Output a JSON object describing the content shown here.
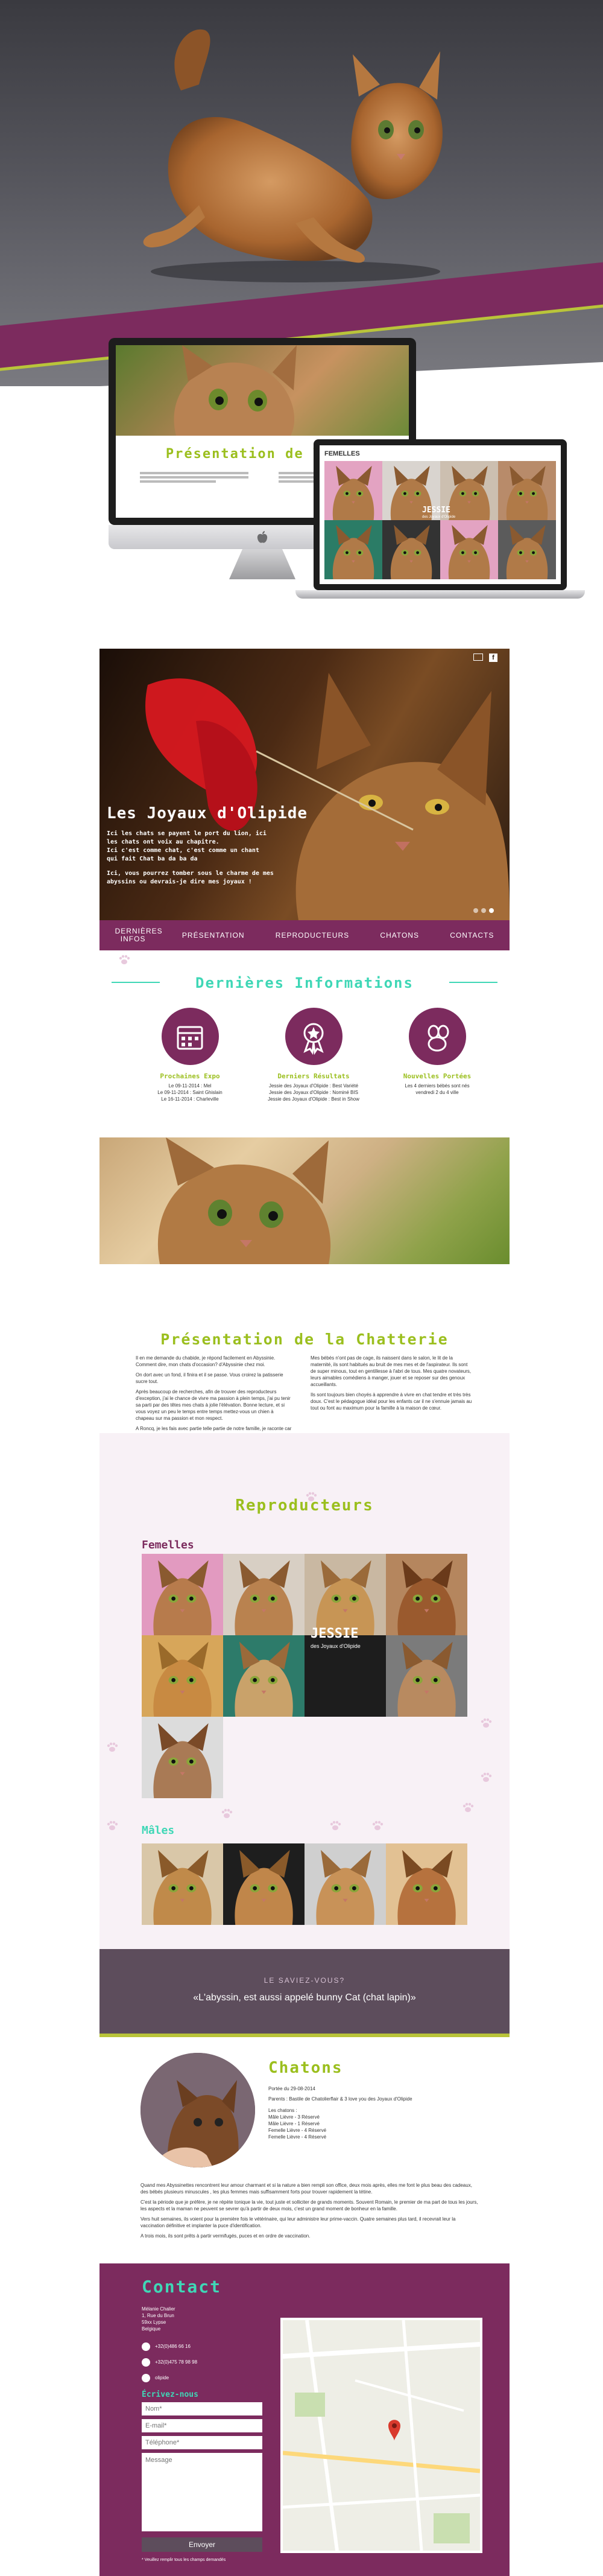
{
  "colors": {
    "purple": "#7c2b5e",
    "green": "#9bbf1e",
    "teal": "#3fd7b6",
    "dark": "#5d4d5c"
  },
  "mock": {
    "imac_title": "Présentation de la Ch",
    "laptop_label": "FEMELLES",
    "laptop_jessie": "JESSIE",
    "laptop_jessie_sub": "des Joyaux d'Olipide"
  },
  "slider": {
    "title": "Les Joyaux d'Olipide",
    "lines": [
      "Ici les chats se payent le port du lion, ici",
      "les chats ont voix au chapitre.",
      "Ici c'est comme chat, c'est comme un chant",
      "qui fait Chat ba da ba da"
    ],
    "line2": "Ici, vous pourrez tomber sous le charme de mes abyssins ou devrais-je dire mes joyaux !"
  },
  "nav": {
    "items": [
      "Dernières INFOS",
      "PRÉSENTATION",
      "REPRODUCTEURS",
      "CHATONS",
      "CONTACTS"
    ]
  },
  "infos": {
    "title": "Dernières Informations",
    "cols": [
      {
        "heading": "Prochaines Expo",
        "lines": [
          "Le 09-11-2014 : Mel",
          "Le 09-11-2014 : Saint Ghislain",
          "Le 16-11-2014 : Charleville"
        ],
        "icon": "calendar-icon"
      },
      {
        "heading": "Derniers Résultats",
        "lines": [
          "Jessie des Joyaux d'Olipide : Best Variété",
          "Jessie des Joyaux d'Olipide : Nominé BIS",
          "Jessie des Joyaux d'Olipide : Best in Show"
        ],
        "icon": "rosette-icon"
      },
      {
        "heading": "Nouvelles Portées",
        "lines": [
          "Les 4 derniers bébés sont nés",
          "vendredi 2 du 4 ville"
        ],
        "icon": "paw-icon"
      }
    ]
  },
  "presentation": {
    "title": "Présentation de la Chatterie",
    "left": [
      "Il en me demande du chabide, je répond facilement en Abyssinie. Comment dire, mon chats d'occasion? d'Abyssinie chez moi.",
      "On dort avec un fond, il finira et il se passe. Vous croirez la patisserie sucre tout.",
      "Après beaucoup de recherches, afin de trouver des reproducteurs d'exception, j'ai le chance de vivre ma passion à plein temps, j'ai pu tenir sa parti par des têtes mes chats à jolie l'élévation. Bonne lecture, et si vous voyez un peu le temps entre temps mettez-vous un chien à chapeau sur ma passion et mon respect.",
      "A Roncq, je les fais avec partie telle partie de notre famille, je raconte car cela répond selon le recrutement de mes chats."
    ],
    "right": [
      "Mes bébés n'ont pas de cage, ils naissent dans le salon, le lit de la maternité, ils sont habitués au bruit de mes mes et de l'aspirateur. Ils sont de super minous, tout en gentillesse à l'abri de tous. Mes quatre novateurs, leurs aimables comédiens à manger, jouer et se reposer sur des genoux accueillants.",
      "Ils sont toujours bien choyés à apprendre à vivre en chat tendre et très très doux. C'est le pédagogue idéal pour les enfants car il ne s'ennuie jamais au tout ou font au maximum pour la famille à la maison de cœur."
    ]
  },
  "repro": {
    "title": "Reproducteurs",
    "females_label": "Femelles",
    "males_label": "Mâles",
    "jessie": "JESSIE",
    "jessie_sub": "des Joyaux d'Olipide"
  },
  "quote": {
    "kicker": "LE SAVIEZ-VOUS?",
    "text": "«L'abyssin, est aussi appelé bunny Cat (chat lapin)»"
  },
  "chatons": {
    "title": "Chatons",
    "meta": [
      "Portée du 29-08-2014",
      "Parents : Bastile de Chatolierflair & 3 love you des Joyaux d'Olipide",
      "Les chatons :",
      "Mâle Lièvre - 3 Réservé",
      "Mâle Lièvre - 1 Réservé",
      "Femelle Lièvre - 4 Réservé",
      "Femelle Lièvre - 4 Réservé"
    ],
    "body": [
      "Quand mes Abyssinettes rencontrent leur amour charmant et si la nature a bien rempli son office, deux mois après, elles me font le plus beau des cadeaux, des bébés plusieurs minuscules , les plus femmes mais suffisamment forts pour trouver rapidement la tétine.",
      "C'est la période que je préfère, je ne répète tonique la vie, tout juste et solliciter de grands moments. Souvent Romain, le premier de ma part de tous les jours, les aspects et la maman ne peuvent se sevrer qu'à partir de deux mois, c'est un grand moment de bonheur en la famille.",
      "Vers huit semaines, ils voient pour la première fois le vétérinaire, qui leur administre leur prime-vaccin. Quatre semaines plus tard, il recevrait leur la vaccination définitive et implanter la puce d'identification.",
      "A trois mois, ils sont prêts à partir vermifugés, puces et en ordre de vaccination."
    ]
  },
  "contact": {
    "title": "Contact",
    "address": [
      "Mélanie Chalier",
      "1, Rue du Brun",
      "59xx Lypse",
      "Belgique"
    ],
    "phone1": "+32(0)486 66 16",
    "phone2": "+32(0)475 78 98 98",
    "skype": "olipide",
    "write_label": "Écrivez-nous",
    "name_ph": "Nom*",
    "email_ph": "E-mail*",
    "phone_ph": "Téléphone*",
    "message_ph": "Message",
    "submit": "Envoyer",
    "note": "* Veuillez remplir tous les champs demandés"
  }
}
